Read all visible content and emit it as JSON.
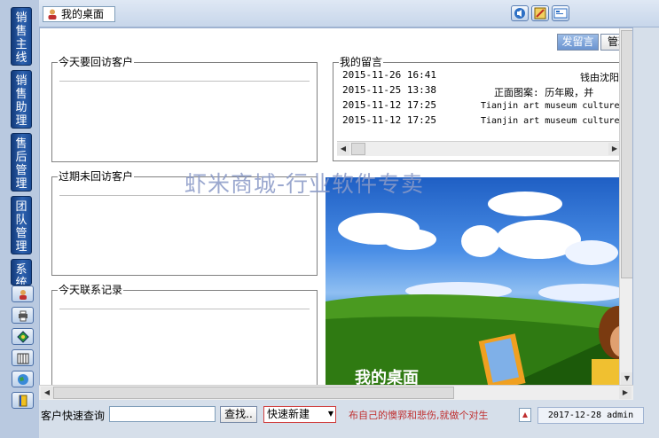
{
  "sidebar": {
    "tabs": [
      {
        "label": "销售主线"
      },
      {
        "label": "销售助理"
      },
      {
        "label": "售后管理"
      },
      {
        "label": "团队管理"
      },
      {
        "label": "系统"
      }
    ],
    "icons": [
      "user-icon",
      "printer-icon",
      "diamond-icon",
      "calendar-icon",
      "globe-icon",
      "book-icon"
    ]
  },
  "topbar": {
    "tab_label": "我的桌面",
    "tool_icons": [
      "speaker-icon",
      "edit-icon",
      "screen-icon"
    ]
  },
  "main": {
    "buttons": {
      "post_message": "发留言",
      "manage": "管理"
    },
    "groups": {
      "today_visit": "今天要回访客户",
      "overdue_visit": "过期未回访客户",
      "today_contact": "今天联系记录",
      "my_messages": "我的留言"
    },
    "messages": [
      {
        "date": "2015-11-26",
        "time": "16:41",
        "text": ""
      },
      {
        "date": "2015-11-25",
        "time": "13:38",
        "text": ""
      },
      {
        "date": "2015-11-12",
        "time": "17:25",
        "text": ""
      },
      {
        "date": "2015-11-12",
        "time": "17:25",
        "text": ""
      }
    ],
    "message_right_rows": [
      "钱由沈阳道",
      "正面图案:          历年殿，并",
      "Tianjin art museum culture",
      "Tianjin art museum culture"
    ],
    "watermark": "虾米商城-行业软件专卖",
    "banner_title": "我的桌面"
  },
  "bottombar": {
    "quick_search_label": "客户快速查询",
    "search_value": "",
    "search_button": "查找..",
    "quick_new_value": "快速新建",
    "ticker": "布自己的懊郛和悲伤,就做个对生",
    "status_date": "2017-12-28",
    "status_user": "admin"
  },
  "colors": {
    "sidebar_tab": "#2f63b0",
    "accent": "#1f5fc4"
  }
}
